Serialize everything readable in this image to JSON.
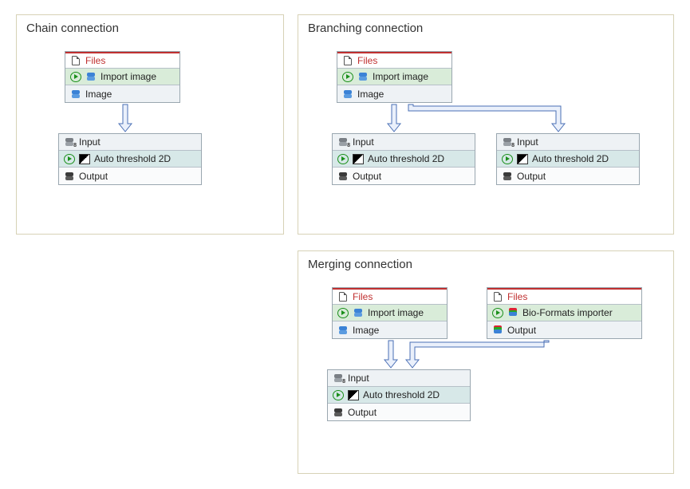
{
  "panels": {
    "chain": {
      "title": "Chain connection"
    },
    "branch": {
      "title": "Branching connection"
    },
    "merge": {
      "title": "Merging connection"
    }
  },
  "labels": {
    "files": "Files",
    "import_image": "Import image",
    "image": "Image",
    "input": "Input",
    "auto_threshold": "Auto threshold 2D",
    "output": "Output",
    "bio_formats": "Bio-Formats importer"
  }
}
